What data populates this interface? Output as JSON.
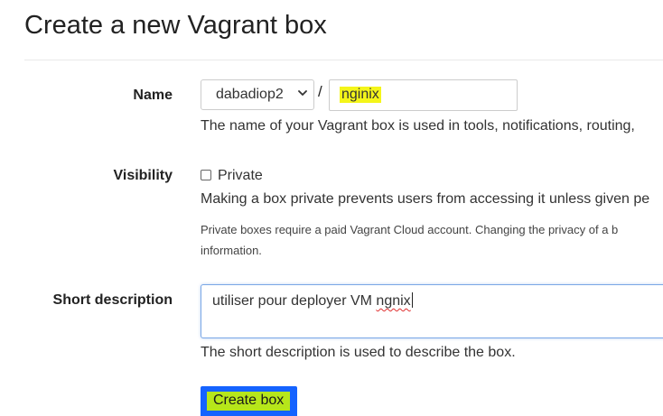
{
  "page": {
    "title": "Create a new Vagrant box"
  },
  "form": {
    "name": {
      "label": "Name",
      "owner_selected": "dabadiop2",
      "separator": "/",
      "box_name_value": "nginix",
      "help": "The name of your Vagrant box is used in tools, notifications, routing,"
    },
    "visibility": {
      "label": "Visibility",
      "checkbox_label": "Private",
      "checked": false,
      "help": "Making a box private prevents users from accessing it unless given pe",
      "note_line1": "Private boxes require a paid Vagrant Cloud account. Changing the privacy of a b",
      "note_line2": "information."
    },
    "short_description": {
      "label": "Short description",
      "value_before": "utiliser pour deployer VM ",
      "value_misspelled": "ngnix",
      "help": "The short description is used to describe the box."
    },
    "submit_label": "Create box"
  },
  "colors": {
    "button_bg": "#1563ff",
    "highlight_yellow": "#f4f51a",
    "highlight_green": "#b6e61a",
    "focus_border": "#7aa7e6"
  },
  "icons": {
    "select_arrow": "chevron-down-icon"
  }
}
